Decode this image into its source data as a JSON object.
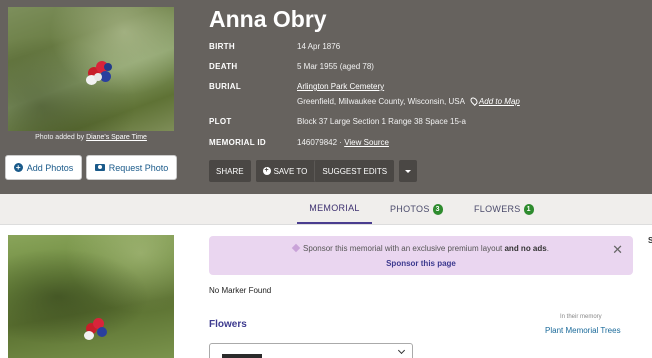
{
  "memorial": {
    "name": "Anna Obry",
    "photo_credit_prefix": "Photo added by",
    "photo_credit_name": "Diane's Spare Time",
    "fields": {
      "birth_label": "BIRTH",
      "birth_value": "14 Apr 1876",
      "death_label": "DEATH",
      "death_value": "5 Mar 1955 (aged 78)",
      "burial_label": "BURIAL",
      "burial_cemetery": "Arlington Park Cemetery",
      "burial_location": "Greenfield, Milwaukee County, Wisconsin, USA",
      "add_to_map": "Add to Map",
      "plot_label": "PLOT",
      "plot_value": "Block 37 Large Section 1 Range 38 Space 15-a",
      "memorial_id_label": "MEMORIAL ID",
      "memorial_id_value": "146079842",
      "memorial_id_sep": "·",
      "view_source": "View Source"
    }
  },
  "photo_buttons": {
    "add_photos": "Add Photos",
    "request_photo": "Request Photo"
  },
  "actions": {
    "share": "SHARE",
    "save_to": "SAVE TO",
    "suggest_edits": "SUGGEST EDITS"
  },
  "tabs": [
    {
      "label": "MEMORIAL",
      "active": true
    },
    {
      "label": "PHOTOS",
      "count": "3"
    },
    {
      "label": "FLOWERS",
      "count": "1"
    }
  ],
  "sponsor": {
    "text": "Sponsor this memorial with an exclusive premium layout",
    "text_bold": "and no ads",
    "text_end": ".",
    "link": "Sponsor this page"
  },
  "no_marker": "No Marker Found",
  "flowers_section": {
    "heading": "Flowers",
    "in_memory": "In their memory",
    "plant_link": "Plant Memorial Trees"
  },
  "edge_letter": "S",
  "colors": {
    "header_bg": "#66625e",
    "accent": "#3d3a8f",
    "badge": "#2e8b2e",
    "sponsor_bg": "#ead6f0"
  },
  "icons": [
    "plus-circle-icon",
    "camera-icon",
    "map-pin-icon",
    "close-icon",
    "diamond-icon",
    "chevron-down-icon",
    "caret-down-icon"
  ]
}
